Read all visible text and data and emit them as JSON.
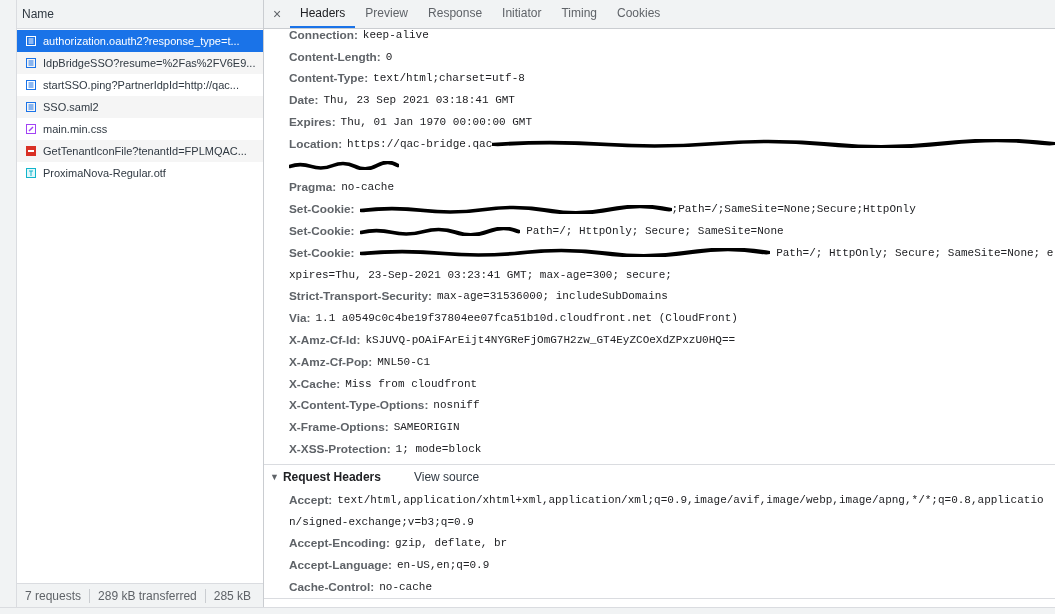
{
  "requests": {
    "column": "Name",
    "items": [
      {
        "name": "authorization.oauth2?response_type=t...",
        "kind": "document",
        "selected": true
      },
      {
        "name": "IdpBridgeSSO?resume=%2Fas%2FV6E9...",
        "kind": "document",
        "selected": false
      },
      {
        "name": "startSSO.ping?PartnerIdpId=http://qac...",
        "kind": "document",
        "selected": false
      },
      {
        "name": "SSO.saml2",
        "kind": "document",
        "selected": false
      },
      {
        "name": "main.min.css",
        "kind": "stylesheet",
        "selected": false
      },
      {
        "name": "GetTenantIconFile?tenantId=FPLMQAC...",
        "kind": "image",
        "selected": false
      },
      {
        "name": "ProximaNova-Regular.otf",
        "kind": "font",
        "selected": false
      }
    ],
    "status": [
      "7 requests",
      "289 kB transferred",
      "285 kB"
    ]
  },
  "detail": {
    "close": "×",
    "tabs": [
      {
        "label": "Headers",
        "selected": true
      },
      {
        "label": "Preview",
        "selected": false
      },
      {
        "label": "Response",
        "selected": false
      },
      {
        "label": "Initiator",
        "selected": false
      },
      {
        "label": "Timing",
        "selected": false
      },
      {
        "label": "Cookies",
        "selected": false
      }
    ],
    "response_headers": [
      {
        "name": "Connection:",
        "lines": [
          [
            {
              "kind": "text",
              "text": "keep-alive"
            }
          ]
        ]
      },
      {
        "name": "Content-Length:",
        "lines": [
          [
            {
              "kind": "text",
              "text": "0"
            }
          ]
        ]
      },
      {
        "name": "Content-Type:",
        "lines": [
          [
            {
              "kind": "text",
              "text": "text/html;charset=utf-8"
            }
          ]
        ]
      },
      {
        "name": "Date:",
        "lines": [
          [
            {
              "kind": "text",
              "text": "Thu, 23 Sep 2021 03:18:41 GMT"
            }
          ]
        ]
      },
      {
        "name": "Expires:",
        "lines": [
          [
            {
              "kind": "text",
              "text": "Thu, 01 Jan 1970 00:00:00 GMT"
            }
          ]
        ]
      },
      {
        "name": "Location:",
        "lines": [
          [
            {
              "kind": "text",
              "text": "https://qac-bridge.qac"
            },
            {
              "kind": "redacted"
            }
          ],
          [
            {
              "kind": "redacted"
            }
          ]
        ]
      },
      {
        "name": "Pragma:",
        "lines": [
          [
            {
              "kind": "text",
              "text": "no-cache"
            }
          ]
        ]
      },
      {
        "name": "Set-Cookie:",
        "lines": [
          [
            {
              "kind": "redacted"
            },
            {
              "kind": "text",
              "text": ";Path=/;SameSite=None;Secure;HttpOnly"
            }
          ]
        ]
      },
      {
        "name": "Set-Cookie:",
        "lines": [
          [
            {
              "kind": "redacted"
            },
            {
              "kind": "text",
              "text": " Path=/; HttpOnly; Secure; SameSite=None"
            }
          ]
        ]
      },
      {
        "name": "Set-Cookie:",
        "lines": [
          [
            {
              "kind": "redacted"
            },
            {
              "kind": "text",
              "text": " Path=/; HttpOnly; Secure; SameSite=None; e"
            }
          ],
          [
            {
              "kind": "text",
              "text": "xpires=Thu, 23-Sep-2021 03:23:41 GMT; max-age=300; secure;"
            }
          ]
        ]
      },
      {
        "name": "Strict-Transport-Security:",
        "lines": [
          [
            {
              "kind": "text",
              "text": "max-age=31536000; includeSubDomains"
            }
          ]
        ]
      },
      {
        "name": "Via:",
        "lines": [
          [
            {
              "kind": "text",
              "text": "1.1 a0549c0c4be19f37804ee07fca51b10d.cloudfront.net (CloudFront)"
            }
          ]
        ]
      },
      {
        "name": "X-Amz-Cf-Id:",
        "lines": [
          [
            {
              "kind": "text",
              "text": "kSJUVQ-pOAiFArEijt4NYGReFjOmG7H2zw_GT4EyZCOeXdZPxzU0HQ=="
            }
          ]
        ]
      },
      {
        "name": "X-Amz-Cf-Pop:",
        "lines": [
          [
            {
              "kind": "text",
              "text": "MNL50-C1"
            }
          ]
        ]
      },
      {
        "name": "X-Cache:",
        "lines": [
          [
            {
              "kind": "text",
              "text": "Miss from cloudfront"
            }
          ]
        ]
      },
      {
        "name": "X-Content-Type-Options:",
        "lines": [
          [
            {
              "kind": "text",
              "text": "nosniff"
            }
          ]
        ]
      },
      {
        "name": "X-Frame-Options:",
        "lines": [
          [
            {
              "kind": "text",
              "text": "SAMEORIGIN"
            }
          ]
        ]
      },
      {
        "name": "X-XSS-Protection:",
        "lines": [
          [
            {
              "kind": "text",
              "text": "1; mode=block"
            }
          ]
        ]
      }
    ],
    "request_section": {
      "arrow": "▼",
      "title": "Request Headers",
      "expanded": true,
      "link": "View source"
    },
    "request_headers": [
      {
        "name": "Accept:",
        "lines": [
          [
            {
              "kind": "text",
              "text": "text/html,application/xhtml+xml,application/xml;q=0.9,image/avif,image/webp,image/apng,*/*;q=0.8,applicatio"
            }
          ],
          [
            {
              "kind": "text",
              "text": "n/signed-exchange;v=b3;q=0.9"
            }
          ]
        ]
      },
      {
        "name": "Accept-Encoding:",
        "lines": [
          [
            {
              "kind": "text",
              "text": "gzip, deflate, br"
            }
          ]
        ]
      },
      {
        "name": "Accept-Language:",
        "lines": [
          [
            {
              "kind": "text",
              "text": "en-US,en;q=0.9"
            }
          ]
        ]
      },
      {
        "name": "Cache-Control:",
        "lines": [
          [
            {
              "kind": "text",
              "text": "no-cache"
            }
          ]
        ]
      }
    ]
  }
}
